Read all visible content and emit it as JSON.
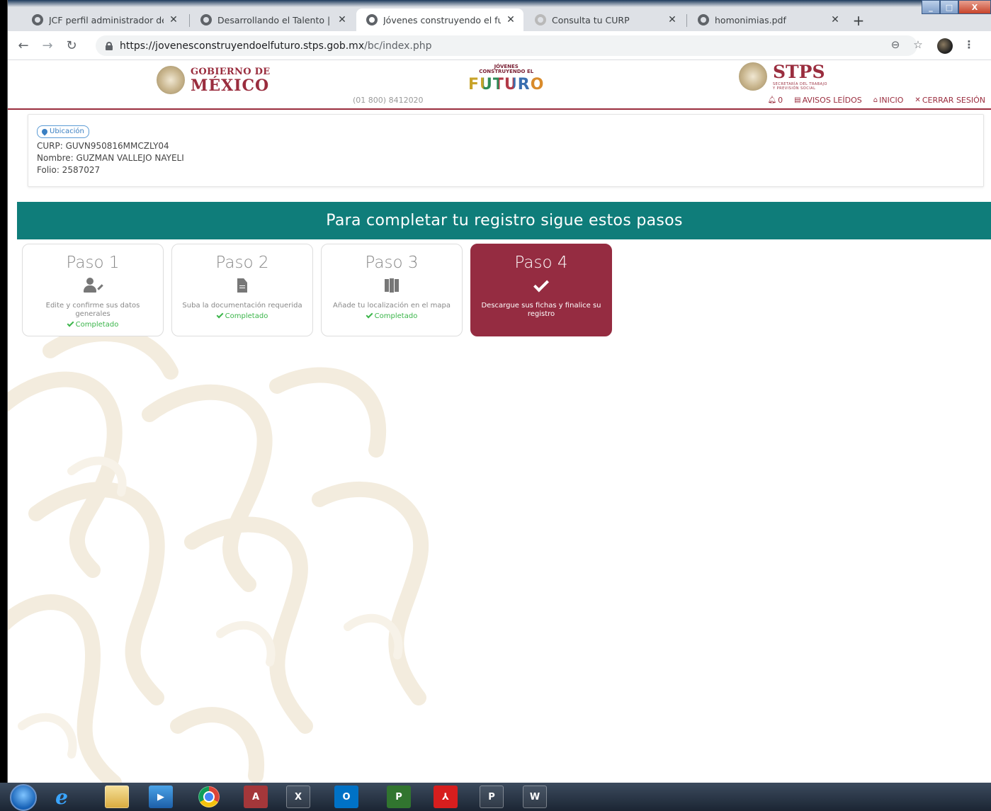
{
  "browser": {
    "tabs": [
      {
        "title": "JCF perfil administrador de e",
        "active": false
      },
      {
        "title": "Desarrollando el Talento | Mé",
        "active": false
      },
      {
        "title": "Jóvenes construyendo el futu",
        "active": true
      },
      {
        "title": "Consulta tu CURP",
        "active": false
      },
      {
        "title": "homonimias.pdf",
        "active": false
      }
    ],
    "url_host": "https://jovenesconstruyendoelfuturo.stps.gob.mx",
    "url_path": "/bc/index.php"
  },
  "header": {
    "gob_line1": "GOBIERNO DE",
    "gob_line2": "MÉXICO",
    "jcf_line1": "JÓVENES",
    "jcf_line2": "CONSTRUYENDO EL",
    "jcf_line3": "FUTURO",
    "phone": "(01 800) 8412020",
    "stps_name": "STPS",
    "stps_sub1": "SECRETARÍA DEL TRABAJO",
    "stps_sub2": "Y PREVISIÓN SOCIAL",
    "nav": {
      "notifications_count": "0",
      "avisos": "AVISOS LEÍDOS",
      "inicio": "INICIO",
      "cerrar": "CERRAR SESIÓN"
    }
  },
  "user": {
    "location_button": "Ubicación",
    "curp": "CURP: GUVN950816MMCZLY04",
    "nombre": "Nombre: GUZMAN VALLEJO NAYELI",
    "folio": "Folio: 2587027"
  },
  "steps_banner": "Para completar tu registro sigue estos pasos",
  "steps": [
    {
      "title": "Paso 1",
      "desc": "Edite y confirme sus datos generales",
      "status": "Completado",
      "icon": "user-edit-icon",
      "active": false
    },
    {
      "title": "Paso 2",
      "desc": "Suba la documentación requerida",
      "status": "Completado",
      "icon": "document-icon",
      "active": false
    },
    {
      "title": "Paso 3",
      "desc": "Añade tu localización en el mapa",
      "status": "Completado",
      "icon": "map-icon",
      "active": false
    },
    {
      "title": "Paso 4",
      "desc": "Descargue sus fichas y finalice su registro",
      "status": "",
      "icon": "check-icon",
      "active": true
    }
  ],
  "taskbar": {
    "access_label": "A",
    "excel_label": "X",
    "outlook_label": "O",
    "project_label": "P",
    "ppt_label": "P",
    "word_label": "W"
  },
  "colors": {
    "brand_red": "#952c41",
    "banner_teal": "#0f7d7a",
    "completed_green": "#3bb54a"
  }
}
